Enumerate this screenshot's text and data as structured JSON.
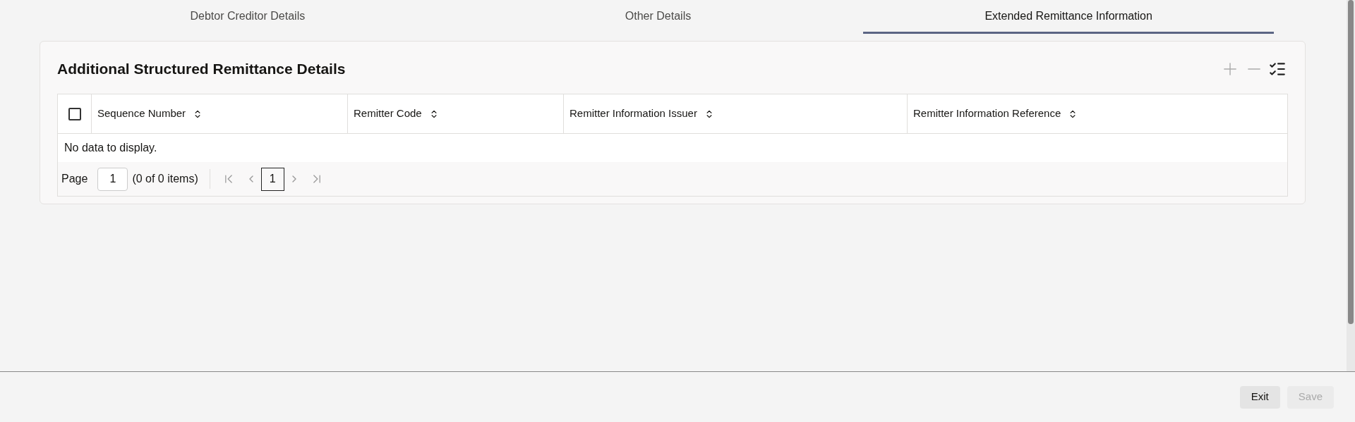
{
  "tabs": [
    {
      "label": "Debtor Creditor Details",
      "selected": false
    },
    {
      "label": "Other Details",
      "selected": false
    },
    {
      "label": "Extended Remittance Information",
      "selected": true
    }
  ],
  "section": {
    "title": "Additional Structured Remittance Details",
    "table": {
      "select_all_checked": false,
      "columns": [
        "Sequence Number",
        "Remitter Code",
        "Remitter Information Issuer",
        "Remitter Information Reference"
      ],
      "empty_message": "No data to display.",
      "pager": {
        "label": "Page",
        "page": "1",
        "summary": "(0 of 0 items)",
        "current": "1"
      }
    }
  },
  "footer": {
    "buttons": [
      {
        "label": "Exit",
        "disabled": false
      },
      {
        "label": "Save",
        "disabled": true
      }
    ]
  }
}
